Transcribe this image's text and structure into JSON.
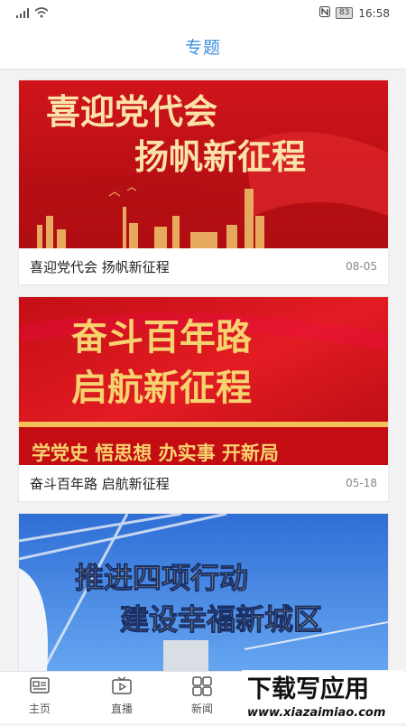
{
  "status_bar": {
    "time": "16:58",
    "battery": "83"
  },
  "header": {
    "title": "专题"
  },
  "cards": [
    {
      "title": "喜迎党代会 扬帆新征程",
      "date": "08-05",
      "banner_lines": [
        "喜迎党代会",
        "扬帆新征程"
      ]
    },
    {
      "title": "奋斗百年路 启航新征程",
      "date": "05-18",
      "banner_lines": [
        "奋斗百年路",
        "启航新征程",
        "学党史 悟思想 办实事 开新局"
      ]
    },
    {
      "title": "",
      "date": "",
      "banner_lines": [
        "推进四项行动",
        "建设幸福新城区"
      ]
    }
  ],
  "nav": [
    {
      "label": "主页",
      "icon": "home-icon"
    },
    {
      "label": "直播",
      "icon": "live-icon"
    },
    {
      "label": "新闻",
      "icon": "news-icon"
    }
  ],
  "watermark": {
    "line1": "下载写应用",
    "line2": "www.xiazaimiao.com"
  },
  "colors": {
    "accent": "#3d8fdd",
    "banner_red": "#c8141a",
    "gold": "#f5d36b"
  }
}
